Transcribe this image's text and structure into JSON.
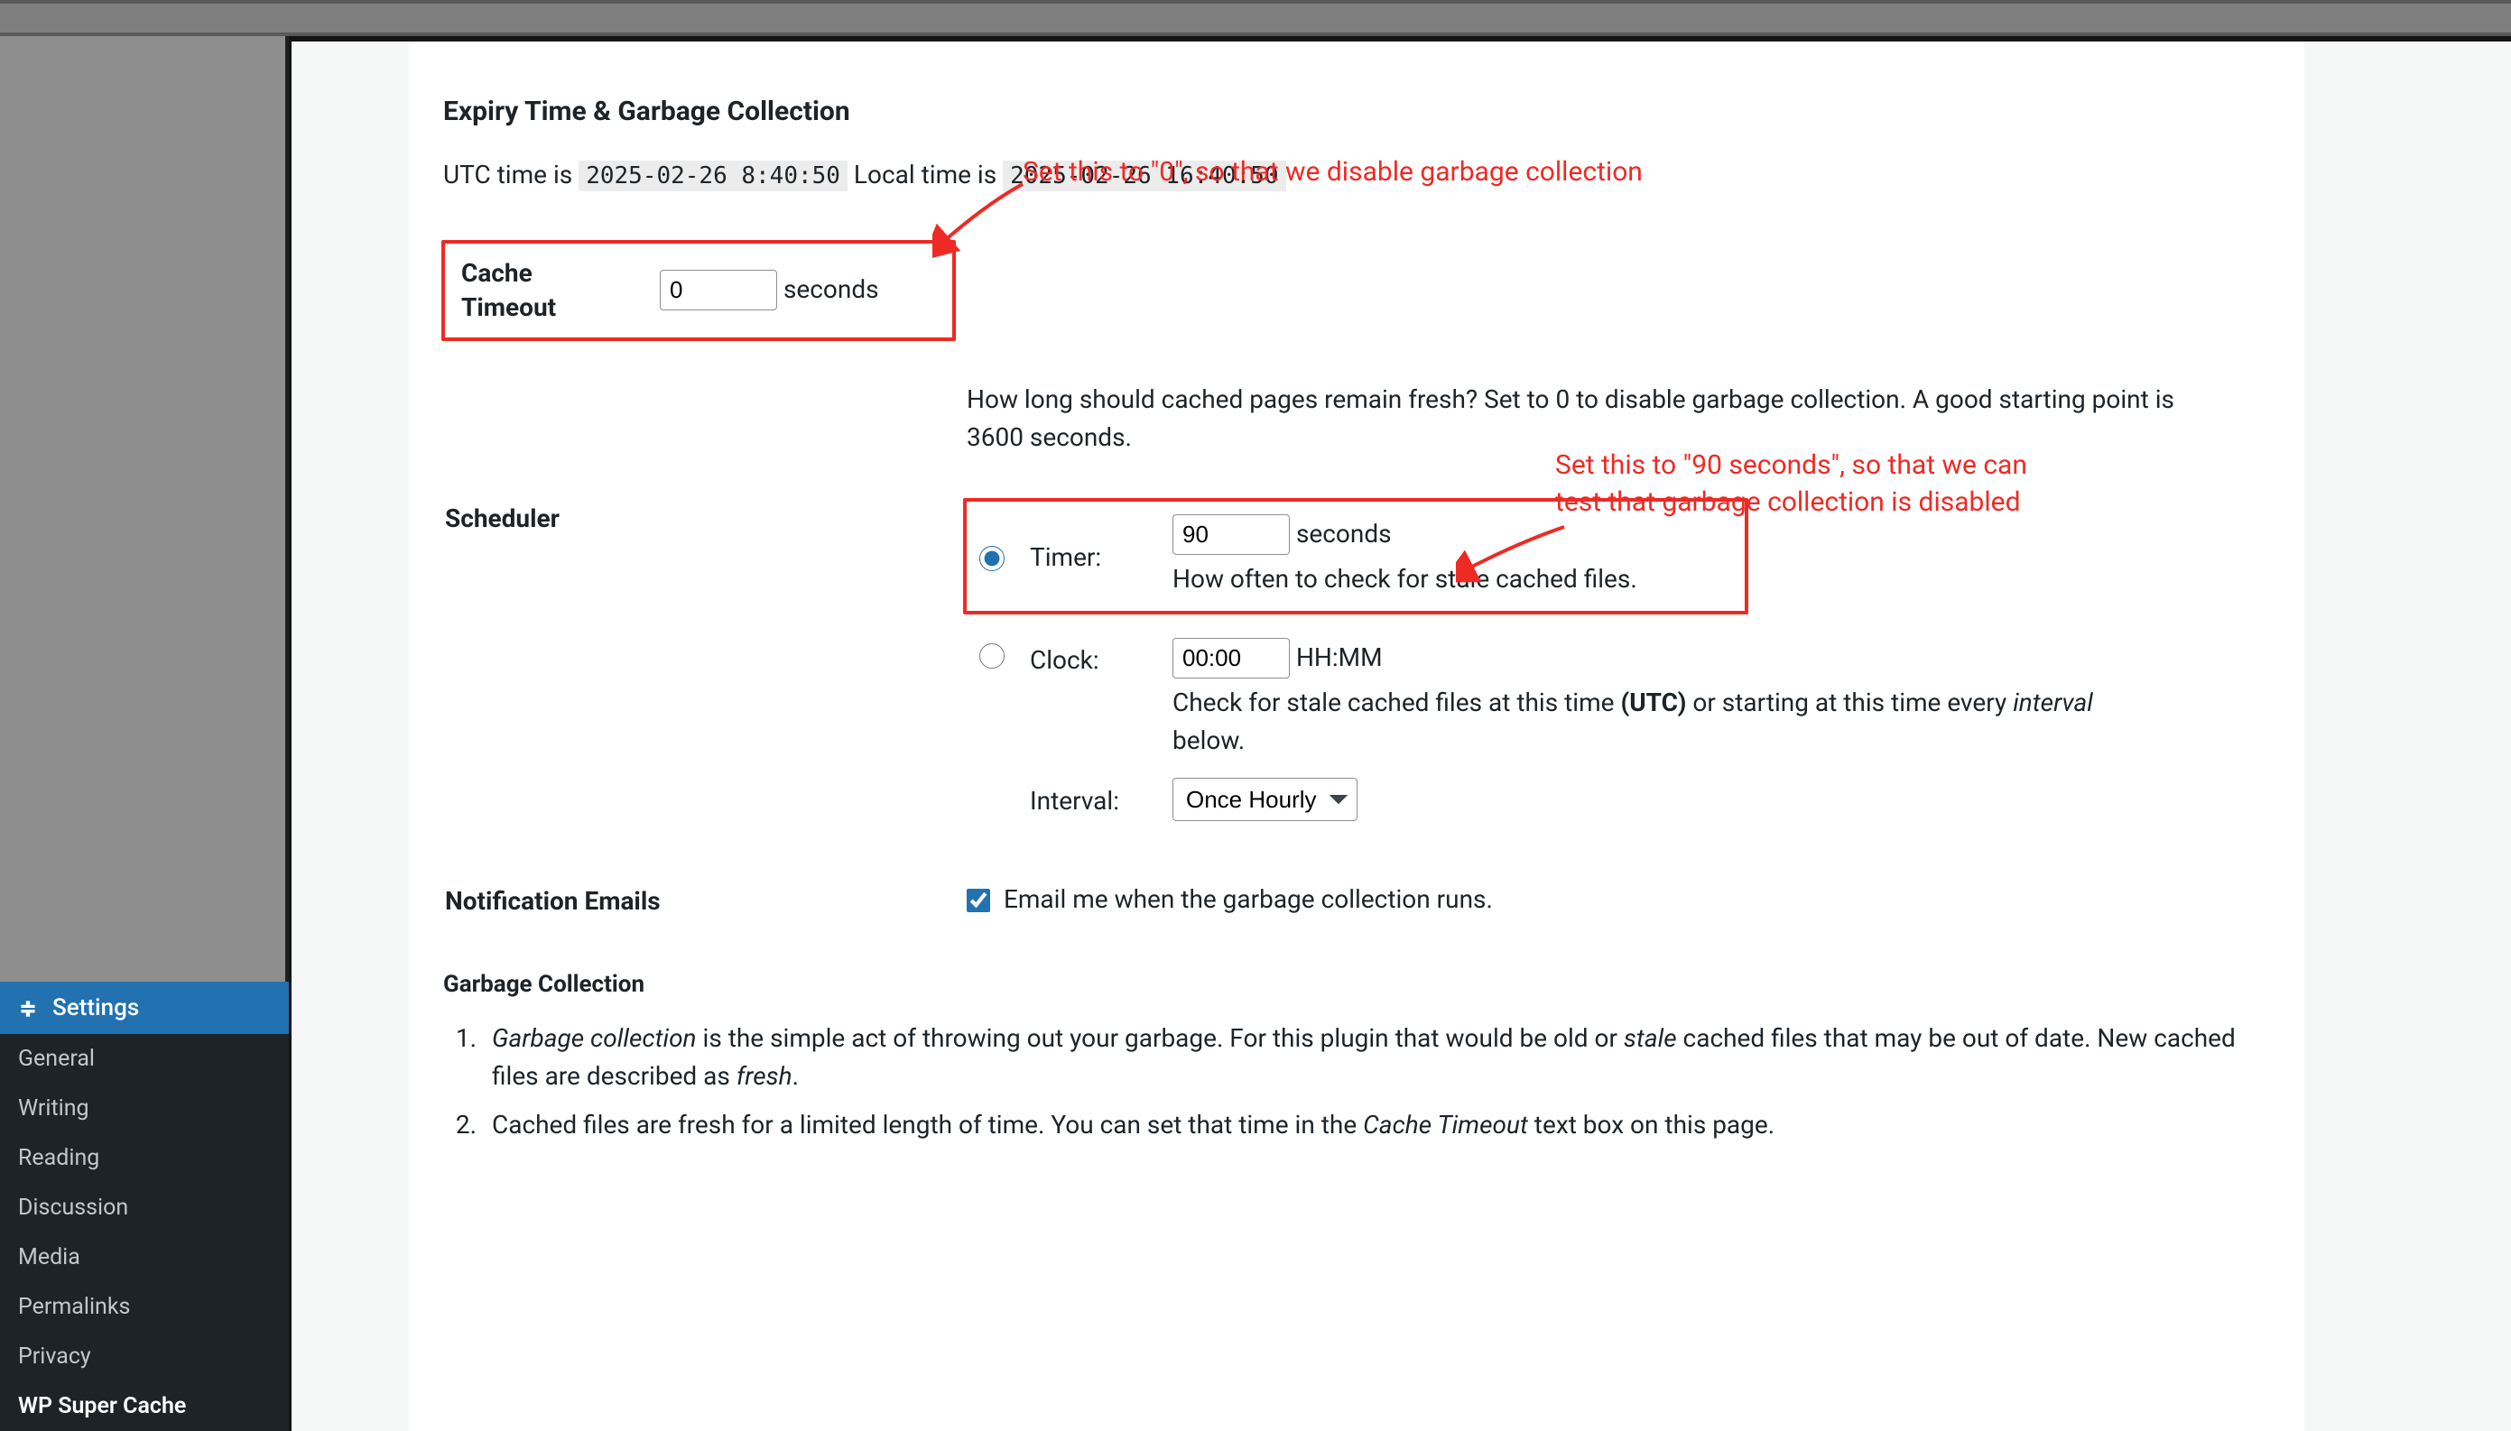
{
  "sidebar": {
    "current": "Settings",
    "items": [
      {
        "label": "General"
      },
      {
        "label": "Writing"
      },
      {
        "label": "Reading"
      },
      {
        "label": "Discussion"
      },
      {
        "label": "Media"
      },
      {
        "label": "Permalinks"
      },
      {
        "label": "Privacy"
      },
      {
        "label": "WP Super Cache",
        "strong": true
      }
    ]
  },
  "header": {
    "title": "Expiry Time & Garbage Collection",
    "utc_label": "UTC time is",
    "utc_time": "2025-02-26 8:40:50",
    "local_label": "Local time is",
    "local_time": "2025-02-26 16:40:50"
  },
  "cache_timeout": {
    "label": "Cache Timeout",
    "value": "0",
    "unit": "seconds",
    "help": "How long should cached pages remain fresh? Set to 0 to disable garbage collection. A good starting point is 3600 seconds."
  },
  "scheduler": {
    "label": "Scheduler",
    "timer": {
      "label": "Timer:",
      "value": "90",
      "unit": "seconds",
      "help": "How often to check for stale cached files."
    },
    "clock": {
      "label": "Clock:",
      "value": "00:00",
      "unit": "HH:MM",
      "help_pre": "Check for stale cached files at this time ",
      "help_bold": "(UTC)",
      "help_mid": " or starting at this time every ",
      "help_em": "interval",
      "help_post": " below."
    },
    "interval": {
      "label": "Interval:",
      "selected": "Once Hourly"
    }
  },
  "notification": {
    "label": "Notification Emails",
    "checkbox_label": "Email me when the garbage collection runs."
  },
  "garbage_collection": {
    "heading": "Garbage Collection",
    "items": [
      {
        "em1": "Garbage collection",
        "t1": " is the simple act of throwing out your garbage. For this plugin that would be old or ",
        "em2": "stale",
        "t2": " cached files that may be out of date. New cached files are described as ",
        "em3": "fresh",
        "t3": "."
      },
      {
        "t1": "Cached files are fresh for a limited length of time. You can set that time in the ",
        "em1": "Cache Timeout",
        "t2": " text box on this page."
      }
    ]
  },
  "annotations": {
    "a1": "Set this to \"0\", so that we disable garbage collection",
    "a2_l1": "Set this to \"90 seconds\", so that we can",
    "a2_l2": "test that garbage collection is disabled"
  }
}
